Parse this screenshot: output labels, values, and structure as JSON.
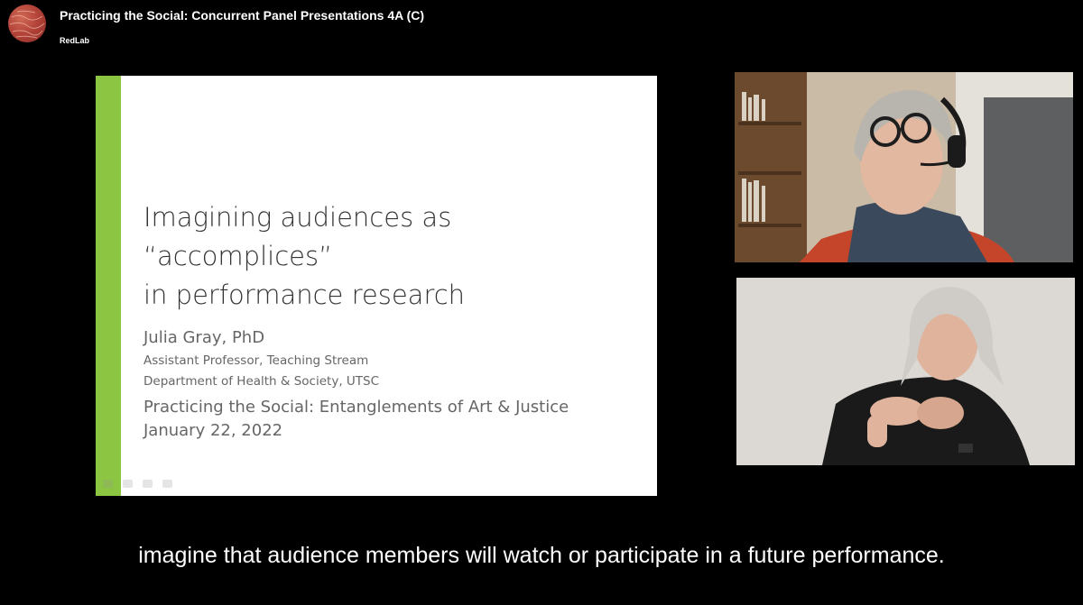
{
  "header": {
    "title": "Practicing the Social: Concurrent Panel Presentations 4A (C)",
    "channel": "RedLab"
  },
  "slide": {
    "title_lines": [
      "Imagining audiences as",
      "“accomplices”",
      "in performance research"
    ],
    "presenter_name": "Julia Gray, PhD",
    "presenter_role": "Assistant Professor, Teaching Stream",
    "presenter_dept": "Department of Health & Society, UTSC",
    "event_name": "Practicing the Social: Entanglements of Art & Justice",
    "event_date": "January 22, 2022",
    "accent_color": "#8cc541"
  },
  "participants": [
    {
      "role": "speaker",
      "icon": "webcam-video"
    },
    {
      "role": "sign-language-interpreter",
      "icon": "webcam-video"
    }
  ],
  "caption": {
    "text": "imagine that audience members will watch or participate in a future performance."
  }
}
